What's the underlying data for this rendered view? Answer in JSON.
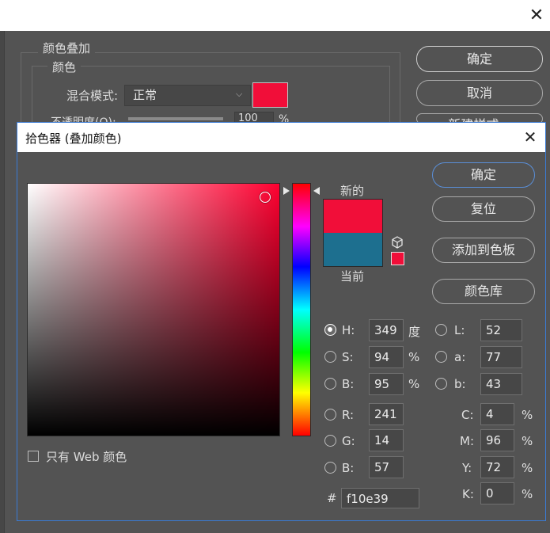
{
  "background_dialog": {
    "close_glyph": "✕",
    "overlay_group_title": "颜色叠加",
    "color_group_title": "颜色",
    "blend_label": "混合模式:",
    "blend_value": "正常",
    "opacity_label": "不透明度(O):",
    "opacity_value": "100",
    "opacity_unit": "%",
    "ok_label": "确定",
    "cancel_label": "取消",
    "new_style_label": "新建样式...",
    "overlay_color": "#f10e39"
  },
  "color_picker": {
    "title": "拾色器 (叠加颜色)",
    "close_glyph": "✕",
    "new_label": "新的",
    "current_label": "当前",
    "new_color": "#f10e39",
    "current_color": "#1d6f8f",
    "buttons": {
      "ok": "确定",
      "reset": "复位",
      "add_to_swatches": "添加到色板",
      "color_libraries": "颜色库"
    },
    "hsb": [
      {
        "label": "H:",
        "value": "349",
        "unit": "度",
        "selected": true
      },
      {
        "label": "S:",
        "value": "94",
        "unit": "%",
        "selected": false
      },
      {
        "label": "B:",
        "value": "95",
        "unit": "%",
        "selected": false
      }
    ],
    "lab": [
      {
        "label": "L:",
        "value": "52"
      },
      {
        "label": "a:",
        "value": "77"
      },
      {
        "label": "b:",
        "value": "43"
      }
    ],
    "rgb": [
      {
        "label": "R:",
        "value": "241"
      },
      {
        "label": "G:",
        "value": "14"
      },
      {
        "label": "B:",
        "value": "57"
      }
    ],
    "cmyk": [
      {
        "label": "C:",
        "value": "4",
        "unit": "%"
      },
      {
        "label": "M:",
        "value": "96",
        "unit": "%"
      },
      {
        "label": "Y:",
        "value": "72",
        "unit": "%"
      },
      {
        "label": "K:",
        "value": "0",
        "unit": "%"
      }
    ],
    "hash_label": "#",
    "hex_value": "f10e39",
    "web_colors_label": "只有 Web 颜色"
  }
}
